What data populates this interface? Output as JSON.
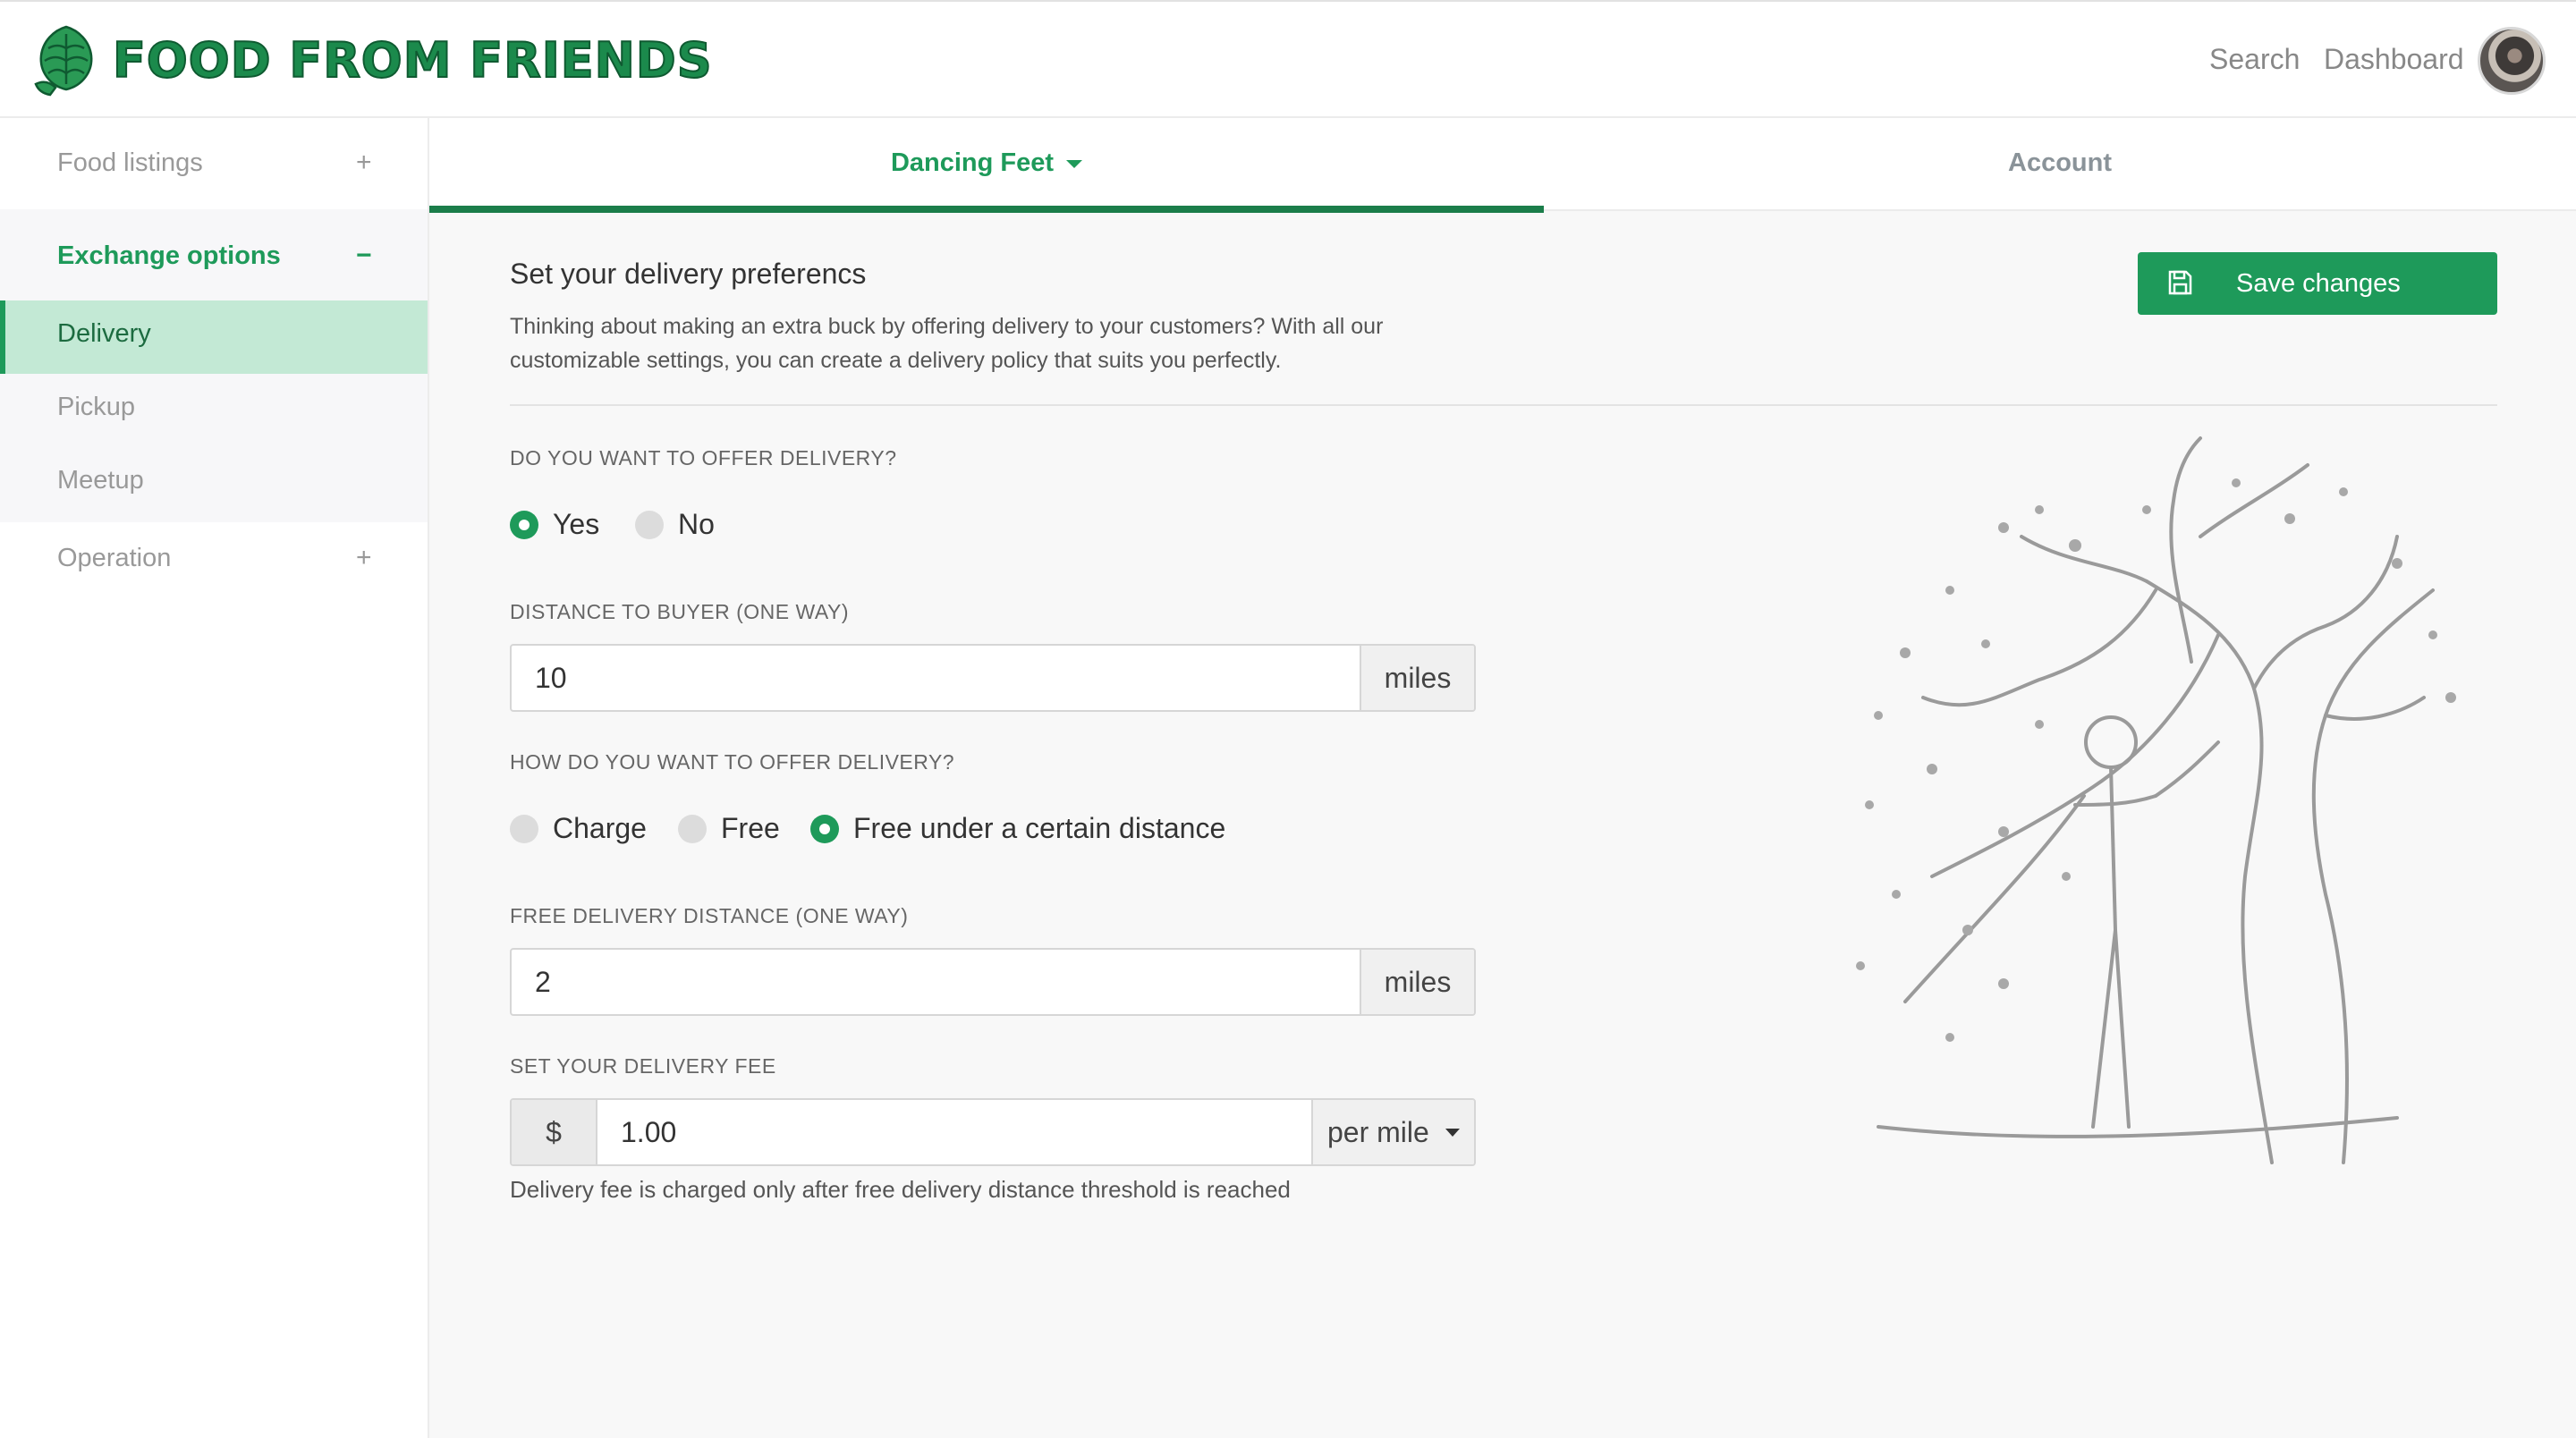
{
  "brand": {
    "name": "FOOD FROM FRIENDS",
    "icon": "artichoke-logo-icon",
    "color": "#1b8a4c"
  },
  "nav": {
    "search": "Search",
    "dashboard": "Dashboard"
  },
  "sidebar": {
    "food_listings": {
      "label": "Food listings",
      "toggle": "+"
    },
    "exchange_options": {
      "label": "Exchange options",
      "toggle": "−",
      "items": [
        {
          "label": "Delivery",
          "active": true
        },
        {
          "label": "Pickup"
        },
        {
          "label": "Meetup"
        }
      ]
    },
    "operation": {
      "label": "Operation",
      "toggle": "+"
    }
  },
  "tabs": {
    "store": "Dancing Feet",
    "account": "Account"
  },
  "main": {
    "title": "Set your delivery preferencs",
    "description": "Thinking about making an extra buck by offering delivery to your customers? With all our customizable settings, you can create a delivery policy that suits you perfectly.",
    "save_button": "Save changes",
    "offer_delivery": {
      "label": "DO YOU WANT TO OFFER DELIVERY?",
      "options": [
        "Yes",
        "No"
      ],
      "selected": "Yes"
    },
    "distance": {
      "label": "DISTANCE TO BUYER (ONE WAY)",
      "value": "10",
      "unit": "miles"
    },
    "delivery_mode": {
      "label": "HOW DO YOU WANT TO OFFER DELIVERY?",
      "options": [
        "Charge",
        "Free",
        "Free under a certain distance"
      ],
      "selected": "Free under a certain distance"
    },
    "free_distance": {
      "label": "FREE DELIVERY DISTANCE (ONE WAY)",
      "value": "2",
      "unit": "miles"
    },
    "fee": {
      "label": "SET YOUR DELIVERY FEE",
      "currency": "$",
      "value": "1.00",
      "unit": "per mile",
      "help": "Delivery fee is charged only after free delivery distance threshold is reached"
    }
  },
  "colors": {
    "accent": "#1e9a5a",
    "accent_dark": "#1b7d4a",
    "active_bg": "#c3e9d5"
  }
}
